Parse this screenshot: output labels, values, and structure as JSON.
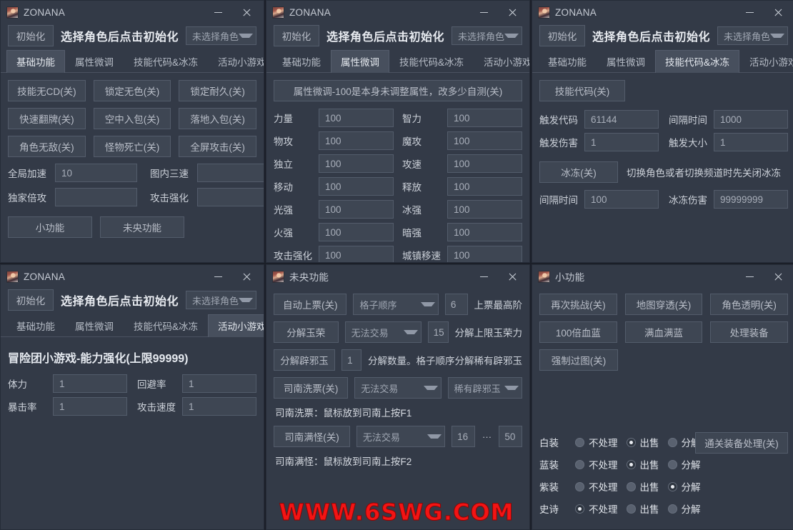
{
  "window": {
    "title_main": "ZONANA",
    "minimize": "–",
    "close": "×"
  },
  "header": {
    "init_button": "初始化",
    "headline": "选择角色后点击初始化",
    "character_select": "未选择角色"
  },
  "tabs": [
    "基础功能",
    "属性微调",
    "技能代码&冰冻",
    "活动小游戏"
  ],
  "panel_basic": {
    "buttons": [
      [
        "技能无CD(关)",
        "锁定无色(关)",
        "锁定耐久(关)"
      ],
      [
        "快速翻牌(关)",
        "空中入包(关)",
        "落地入包(关)"
      ],
      [
        "角色无敌(关)",
        "怪物死亡(关)",
        "全屏攻击(关)"
      ]
    ],
    "fields": [
      {
        "label": "全局加速",
        "value": "10"
      },
      {
        "label": "图内三速",
        "value": ""
      },
      {
        "label": "独家倍攻",
        "value": ""
      },
      {
        "label": "攻击强化",
        "value": ""
      }
    ],
    "bottom_buttons": [
      "小功能",
      "未央功能"
    ]
  },
  "panel_attr": {
    "notice": "属性微调-100是本身未调整属性，改多少自测(关)",
    "fields": [
      {
        "label": "力量",
        "value": "100"
      },
      {
        "label": "智力",
        "value": "100"
      },
      {
        "label": "物攻",
        "value": "100"
      },
      {
        "label": "魔攻",
        "value": "100"
      },
      {
        "label": "独立",
        "value": "100"
      },
      {
        "label": "攻速",
        "value": "100"
      },
      {
        "label": "移动",
        "value": "100"
      },
      {
        "label": "释放",
        "value": "100"
      },
      {
        "label": "光强",
        "value": "100"
      },
      {
        "label": "冰强",
        "value": "100"
      },
      {
        "label": "火强",
        "value": "100"
      },
      {
        "label": "暗强",
        "value": "100"
      },
      {
        "label": "攻击强化",
        "value": "100"
      },
      {
        "label": "城镇移速",
        "value": "100"
      }
    ]
  },
  "panel_skill": {
    "skill_code_button": "技能代码(关)",
    "fields": [
      {
        "label": "触发代码",
        "value": "61144"
      },
      {
        "label": "间隔时间",
        "value": "1000"
      },
      {
        "label": "触发伤害",
        "value": "1"
      },
      {
        "label": "触发大小",
        "value": "1"
      }
    ],
    "freeze_button": "冰冻(关)",
    "freeze_note": "切换角色或者切换频道时先关闭冰冻",
    "freeze_fields": [
      {
        "label": "间隔时间",
        "value": "100"
      },
      {
        "label": "冰冻伤害",
        "value": "99999999"
      }
    ]
  },
  "panel_game": {
    "heading": "冒险团小游戏-能力强化(上限99999)",
    "fields": [
      {
        "label": "体力",
        "value": "1"
      },
      {
        "label": "回避率",
        "value": "1"
      },
      {
        "label": "暴击率",
        "value": "1"
      },
      {
        "label": "攻击速度",
        "value": "1"
      }
    ]
  },
  "panel_weiyang": {
    "title": "未央功能",
    "rows": [
      {
        "button": "自动上票(关)",
        "combo": "格子顺序",
        "num": "6",
        "note": "上票最高阶"
      },
      {
        "button": "分解玉荣",
        "combo": "无法交易",
        "num": "15",
        "note": "分解上限玉荣力"
      }
    ],
    "row3": {
      "button": "分解辟邪玉",
      "num": "1",
      "note": "分解数量。格子顺序分解稀有辟邪玉"
    },
    "row4": {
      "button": "司南洗票(关)",
      "combo1": "无法交易",
      "combo2": "稀有辟邪玉"
    },
    "hint1": "司南洗票：鼠标放到司南上按F1",
    "row5": {
      "button": "司南满怪(关)",
      "combo": "无法交易",
      "num1": "16",
      "sep": "···",
      "num2": "50"
    },
    "hint2": "司南满怪：鼠标放到司南上按F2"
  },
  "panel_xiao": {
    "title": "小功能",
    "buttons": [
      [
        "再次挑战(关)",
        "地图穿透(关)",
        "角色透明(关)"
      ],
      [
        "100倍血蓝",
        "满血满蓝",
        "处理装备"
      ],
      [
        "强制过图(关)"
      ]
    ],
    "gear_process_button": "通关装备处理(关)",
    "gear_options": [
      "不处理",
      "出售",
      "分解"
    ],
    "gear_rows": [
      {
        "label": "白装",
        "selected": 1
      },
      {
        "label": "蓝装",
        "selected": 1
      },
      {
        "label": "紫装",
        "selected": 2
      },
      {
        "label": "史诗",
        "selected": 0
      }
    ]
  },
  "watermark": "WWW.6SWG.COM",
  "colors": {
    "panel_bg": "#333a47",
    "control_bg": "#3e4653",
    "accent_text": "#e9ecf1",
    "watermark": "#f31414"
  }
}
